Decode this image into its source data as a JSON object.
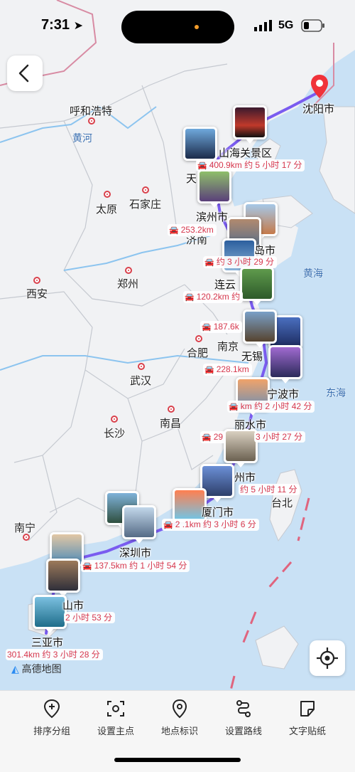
{
  "status": {
    "time": "7:31",
    "network": "5G"
  },
  "map": {
    "cities": [
      {
        "name": "呼和浩特"
      },
      {
        "name": "太原"
      },
      {
        "name": "石家庄"
      },
      {
        "name": "郑州"
      },
      {
        "name": "西安"
      },
      {
        "name": "合肥"
      },
      {
        "name": "南京"
      },
      {
        "name": "武汉"
      },
      {
        "name": "长沙"
      },
      {
        "name": "南昌"
      },
      {
        "name": "南宁"
      },
      {
        "name": "台北"
      },
      {
        "name": "济南"
      }
    ],
    "water": [
      "黄河",
      "黄海",
      "东海"
    ],
    "stops": [
      {
        "name": "沈阳市"
      },
      {
        "name": "山海关景区"
      },
      {
        "name": "滨州市"
      },
      {
        "name": "连云"
      },
      {
        "name": "无锡"
      },
      {
        "name": "宁波市"
      },
      {
        "name": "丽水市"
      },
      {
        "name": "州市"
      },
      {
        "name": "厦门市"
      },
      {
        "name": "深圳市"
      },
      {
        "name": "三亚市"
      },
      {
        "name": "天"
      },
      {
        "name": "岛市"
      },
      {
        "name": "山市"
      }
    ],
    "segments": [
      {
        "text": "400.9km 约 5 小时 17 分"
      },
      {
        "text": "253.2km"
      },
      {
        "text": "约 3 小时 29 分"
      },
      {
        "text": "120.2km 约"
      },
      {
        "text": "187.6k"
      },
      {
        "text": "228.1km"
      },
      {
        "text": "km 约 2 小时 42 分"
      },
      {
        "text": "29"
      },
      {
        "text": "3 小时 27 分"
      },
      {
        "text": "约 5 小时 11 分"
      },
      {
        "text": "2 .1km 约 3 小时 6 分"
      },
      {
        "text": "137.5km 约 1 小时 54 分"
      },
      {
        "text": "2 小时 53 分"
      },
      {
        "text": "301.4km 约 3 小时 28 分"
      }
    ],
    "route_color": "#7a5cf0",
    "logo": "高德地图"
  },
  "toolbar": {
    "items": [
      {
        "label": "排序分组",
        "icon": "pin-add-icon"
      },
      {
        "label": "设置主点",
        "icon": "focus-icon"
      },
      {
        "label": "地点标识",
        "icon": "location-pin-icon"
      },
      {
        "label": "设置路线",
        "icon": "route-icon"
      },
      {
        "label": "文字贴纸",
        "icon": "sticker-icon"
      }
    ]
  }
}
